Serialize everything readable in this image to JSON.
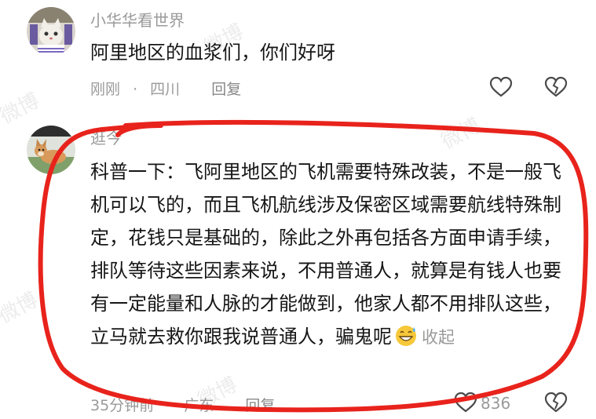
{
  "comments": [
    {
      "username": "小华华看世界",
      "text": "阿里地区的血浆们，你们好呀",
      "time": "刚刚",
      "location": "四川",
      "reply_label": "回复",
      "icons": {
        "like": "heart-outline-icon",
        "dislike": "broken-heart-icon",
        "avatar": "cat-avatar"
      }
    },
    {
      "username": "逛今",
      "text": "科普一下：飞阿里地区的飞机需要特殊改装，不是一般飞机可以飞的，而且飞机航线涉及保密区域需要航线特殊制定，花钱只是基础的，除此之外再包括各方面申请手续，排队等待这些因素来说，不用普通人，就算是有钱人也要有一定能量和人脉的才能做到，他家人都不用排队这些，立马就去救你跟我说普通人，骗鬼呢",
      "collapse_label": "收起",
      "time": "35分钟前",
      "location": "广东",
      "reply_label": "回复",
      "like_count": "836",
      "icons": {
        "like": "heart-outline-icon",
        "dislike": "broken-heart-icon",
        "avatar": "dog-avatar",
        "emoji": "grinning-sweat-emoji"
      }
    }
  ],
  "watermark": "微博",
  "colors": {
    "annotation": "#e8231c",
    "text": "#161616",
    "muted": "#9a9a9a"
  }
}
